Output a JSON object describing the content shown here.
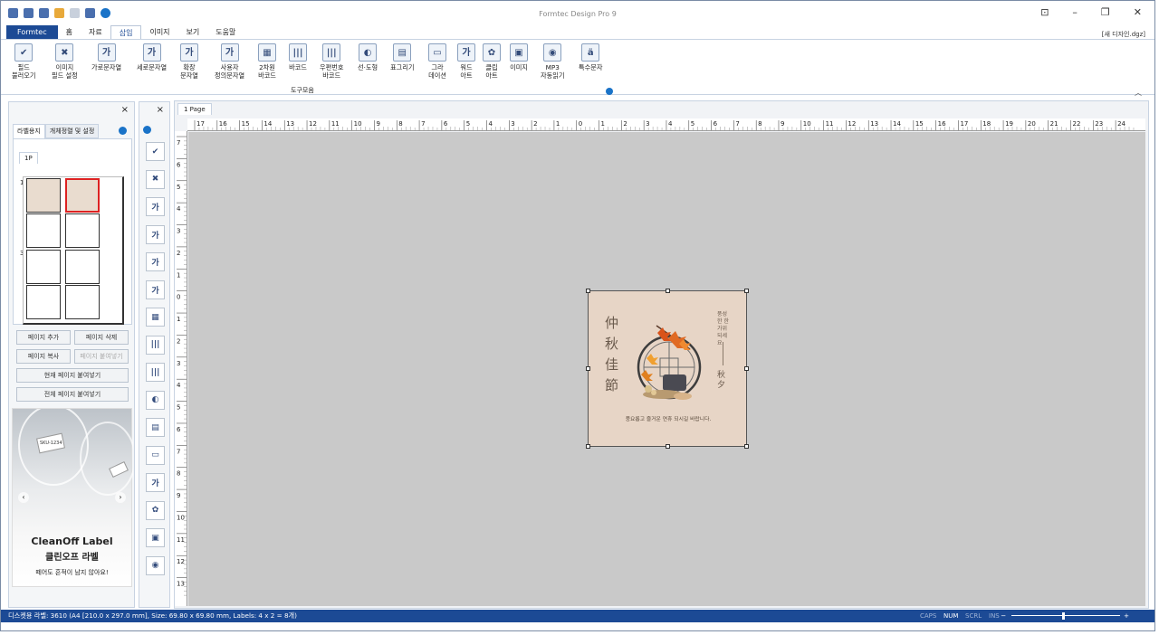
{
  "window": {
    "title": "Formtec Design Pro 9",
    "filename": "[새 디자인.dgz]"
  },
  "tabs": [
    "Formtec",
    "홈",
    "자료",
    "삽입",
    "이미지",
    "보기",
    "도움말"
  ],
  "ribbon": {
    "items": [
      {
        "label": "필드\n불러오기",
        "icon": "✔"
      },
      {
        "label": "이미지\n필드 설정",
        "icon": "✖"
      },
      {
        "label": "가로문자열",
        "icon": "가"
      },
      {
        "label": "세로문자열",
        "icon": "가"
      },
      {
        "label": "확장\n문자열",
        "icon": "가"
      },
      {
        "label": "사용자\n정의문자열",
        "icon": "가"
      },
      {
        "label": "2차원\n바코드",
        "icon": "▦"
      },
      {
        "label": "바코드",
        "icon": "|||"
      },
      {
        "label": "우편번호\n바코드",
        "icon": "|||"
      },
      {
        "label": "선·도형",
        "icon": "◐"
      },
      {
        "label": "표그리기",
        "icon": "▤"
      },
      {
        "label": "그라\n데이션",
        "icon": "▭"
      },
      {
        "label": "워드\n아트",
        "icon": "가"
      },
      {
        "label": "클립\n아트",
        "icon": "✿"
      },
      {
        "label": "이미지",
        "icon": "▣"
      },
      {
        "label": "MP3\n자동읽기",
        "icon": "◉"
      },
      {
        "label": "특수문자",
        "icon": "ä"
      }
    ],
    "group_label": "도구모음"
  },
  "left_panel": {
    "tabs": [
      "라벨용지",
      "개체정렬 및 설정"
    ],
    "page_tab": "1P",
    "row_labels": [
      "1",
      "3"
    ],
    "buttons": {
      "add_page": "페이지 추가",
      "delete_page": "페이지 삭제",
      "copy_page": "페이지 복사",
      "paste_page": "페이지 붙여넣기",
      "paste_current": "현재 페이지 붙여넣기",
      "paste_all": "전체 페이지 붙여넣기"
    },
    "ad": {
      "line1": "CleanOff Label",
      "line2": "클린오프 라벨",
      "line3": "떼어도 흔적이 남지 않아요!",
      "barcode_text": "SKU-1234"
    }
  },
  "document": {
    "tab": "1 Page",
    "label": {
      "title_vertical": "仲秋佳節",
      "greeting_vertical": "풍성한 한가위 되세요",
      "subtitle": "秋夕",
      "message": "풍요롭고 즐거운 연휴 되시길 바랍니다."
    },
    "h_ruler_labels": [
      "17",
      "16",
      "15",
      "14",
      "13",
      "12",
      "11",
      "10",
      "9",
      "8",
      "7",
      "6",
      "5",
      "4",
      "3",
      "2",
      "1",
      "0",
      "1",
      "2",
      "3",
      "4",
      "5",
      "6",
      "7",
      "8",
      "9",
      "10",
      "11",
      "12",
      "13",
      "14",
      "15",
      "16",
      "17",
      "18",
      "19",
      "20",
      "21",
      "22",
      "23",
      "24"
    ],
    "v_ruler_labels": [
      "7",
      "6",
      "5",
      "4",
      "3",
      "2",
      "1",
      "0",
      "1",
      "2",
      "3",
      "4",
      "5",
      "6",
      "7",
      "8",
      "9",
      "10",
      "11",
      "12",
      "13"
    ]
  },
  "status": {
    "text": "디스켓용 라벨: 3610 (A4 [210.0 x 297.0 mm], Size: 69.80 x 69.80 mm,  Labels: 4 x 2 = 8개)",
    "indicators": [
      "CAPS",
      "NUM",
      "SCRL",
      "INS"
    ],
    "zoom_minus": "−",
    "zoom_plus": "+"
  }
}
